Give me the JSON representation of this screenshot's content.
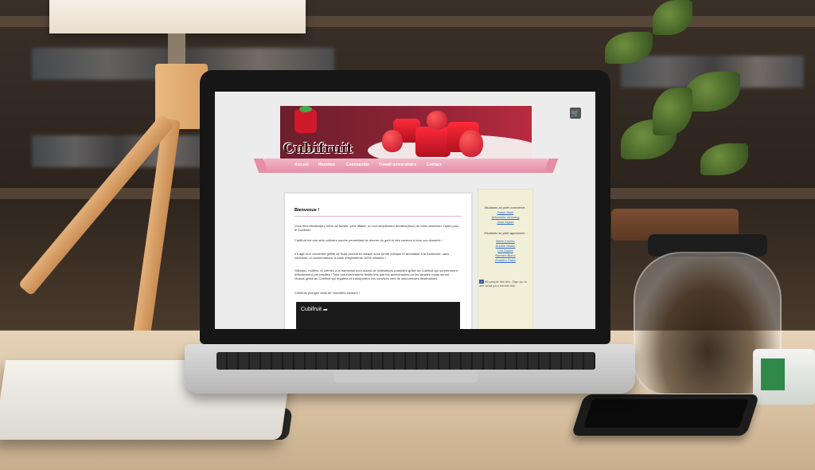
{
  "site": {
    "logo": "Cubifruit",
    "cart_icon": "cart-icon",
    "nav": [
      "Accueil",
      "Recettes",
      "Commander",
      "Travail universitaire",
      "Contact"
    ],
    "content": {
      "heading": "Bienvenue !",
      "p1": "Vous êtes étudiant(e), mère de famille, père affairé, ou tout simplement amateur(trice) de bons desserts? Optez pour le Cubifruit !",
      "p2": "Cubifruit est une aide culinaire sucrée permettant de donner du goût et des saveurs à tous vos desserts !",
      "p3": "Il s'agit d'un concentré gélifié de fruits produit en Alsace sous forme cubique et aromatisé à la framboise, sans colorants, ni conservateurs, à base d'ingrédients 100% naturels !",
      "p4": "Gâteaux, muffins, et crèmes à la framboise sont autant de réalisations possibles grâce au Cubifruit qui surprendront délicatement vos papilles ! Tous vos événements festifs tels que les anniversaires ou les simples repas seront réussis grâce au Cubifruit qui régalera et transportera vos convives vers de savoureuses destinations.",
      "p5": "Cubifruit, plongez dans de nouvelles saveurs !",
      "video_title": "Cubifruit"
    },
    "sidebar": {
      "heading1": "Etudiants au pôle commerce :",
      "links1": [
        "Ralph Abell",
        "Alexandre Viravong",
        "Jean Ziguer"
      ],
      "heading2": "Etudiants au pôle agronomie :",
      "links2": [
        "Marie Kircher",
        "Aurélie Martin",
        "Léa Dupire",
        "Barbara Bianc",
        "Amadou Diallo"
      ],
      "facebook_text": "69 people like this. Sign Up to see what your friends like."
    }
  }
}
